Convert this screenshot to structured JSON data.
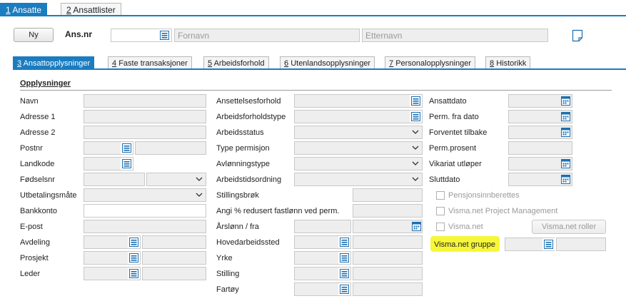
{
  "top_tabs": [
    {
      "num": "1",
      "label": "Ansatte",
      "active": true
    },
    {
      "num": "2",
      "label": "Ansattlister",
      "active": false
    }
  ],
  "header": {
    "new_button": "Ny",
    "ansnr_label": "Ans.nr",
    "ansnr_value": "",
    "fornavn_placeholder": "Fornavn",
    "etternavn_placeholder": "Etternavn"
  },
  "sub_tabs": [
    {
      "num": "3",
      "label": "Ansattopplysninger",
      "active": true
    },
    {
      "num": "4",
      "label": "Faste transaksjoner",
      "active": false
    },
    {
      "num": "5",
      "label": "Arbeidsforhold",
      "active": false
    },
    {
      "num": "6",
      "label": "Utenlandsopplysninger",
      "active": false
    },
    {
      "num": "7",
      "label": "Personalopplysninger",
      "active": false
    },
    {
      "num": "8",
      "label": "Historikk",
      "active": false
    }
  ],
  "section_title": "Opplysninger",
  "col1": {
    "navn": "Navn",
    "adresse1": "Adresse 1",
    "adresse2": "Adresse 2",
    "postnr": "Postnr",
    "landkode": "Landkode",
    "fodselsnr": "Fødselsnr",
    "utbetalingsmate": "Utbetalingsmåte",
    "bankkonto": "Bankkonto",
    "epost": "E-post",
    "avdeling": "Avdeling",
    "prosjekt": "Prosjekt",
    "leder": "Leder"
  },
  "col2": {
    "ansettelsesforhold": "Ansettelsesforhold",
    "arbeidsforholdstype": "Arbeidsforholdstype",
    "arbeidsstatus": "Arbeidsstatus",
    "type_permisjon": "Type permisjon",
    "avlonningstype": "Avlønningstype",
    "arbeidstidsordning": "Arbeidstidsordning",
    "stillingsbrok": "Stillingsbrøk",
    "angi_redusert": "Angi % redusert fastlønn ved perm.",
    "arslonn": "Årslønn / fra",
    "hovedarbeidssted": "Hovedarbeidssted",
    "yrke": "Yrke",
    "stilling": "Stilling",
    "fartoy": "Fartøy"
  },
  "col3": {
    "ansattdato": "Ansattdato",
    "perm_fra_dato": "Perm. fra dato",
    "forventet_tilbake": "Forventet tilbake",
    "perm_prosent": "Perm.prosent",
    "vikariat_utloper": "Vikariat utløper",
    "sluttdato": "Sluttdato",
    "pensjonsinnberettes": "Pensjonsinnberettes",
    "visma_pm": "Visma.net Project Management",
    "visma_net": "Visma.net",
    "visma_roller_button": "Visma.net roller",
    "visma_gruppe": "Visma.net gruppe"
  },
  "colors": {
    "accent": "#1b7cbf",
    "highlight": "#f7f739",
    "field_bg": "#eeeeee"
  }
}
